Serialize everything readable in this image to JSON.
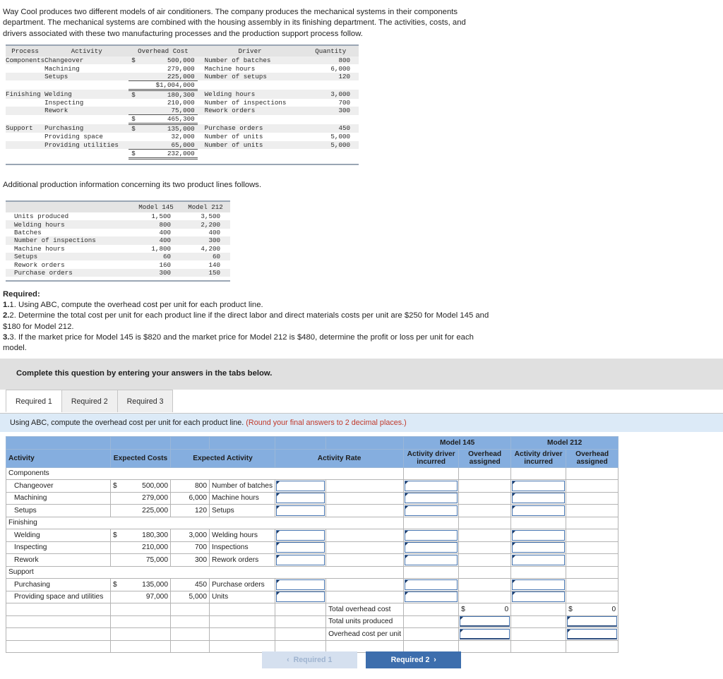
{
  "intro": "Way Cool produces two different models of air conditioners. The company produces the mechanical systems in their components department. The mechanical systems are combined with the housing assembly in its finishing department. The activities, costs, and drivers associated with these two manufacturing processes and the production support process follow.",
  "process_table": {
    "headers": [
      "Process",
      "Activity",
      "Overhead Cost",
      "Driver",
      "Quantity"
    ],
    "rows": [
      {
        "process": "Components",
        "activity": "Changeover",
        "dollar": "$",
        "cost": "500,000",
        "driver": "Number of batches",
        "qty": "800"
      },
      {
        "process": "",
        "activity": "Machining",
        "dollar": "",
        "cost": "279,000",
        "driver": "Machine hours",
        "qty": "6,000"
      },
      {
        "process": "",
        "activity": "Setups",
        "dollar": "",
        "cost": "225,000",
        "driver": "Number of setups",
        "qty": "120"
      },
      {
        "process": "",
        "activity": "",
        "dollar": "",
        "cost": "$1,004,000",
        "driver": "",
        "qty": ""
      },
      {
        "process": "Finishing",
        "activity": "Welding",
        "dollar": "$",
        "cost": "180,300",
        "driver": "Welding hours",
        "qty": "3,000"
      },
      {
        "process": "",
        "activity": "Inspecting",
        "dollar": "",
        "cost": "210,000",
        "driver": "Number of inspections",
        "qty": "700"
      },
      {
        "process": "",
        "activity": "Rework",
        "dollar": "",
        "cost": "75,000",
        "driver": "Rework orders",
        "qty": "300"
      },
      {
        "process": "",
        "activity": "",
        "dollar": "$",
        "cost": "465,300",
        "driver": "",
        "qty": ""
      },
      {
        "process": "Support",
        "activity": "Purchasing",
        "dollar": "$",
        "cost": "135,000",
        "driver": "Purchase orders",
        "qty": "450"
      },
      {
        "process": "",
        "activity": "Providing space",
        "dollar": "",
        "cost": "32,000",
        "driver": "Number of units",
        "qty": "5,000"
      },
      {
        "process": "",
        "activity": "Providing utilities",
        "dollar": "",
        "cost": "65,000",
        "driver": "Number of units",
        "qty": "5,000"
      },
      {
        "process": "",
        "activity": "",
        "dollar": "$",
        "cost": "232,000",
        "driver": "",
        "qty": ""
      }
    ]
  },
  "additional_note": "Additional production information concerning its two product lines follows.",
  "models_table": {
    "headers": [
      "",
      "Model 145",
      "Model 212"
    ],
    "rows": [
      {
        "label": "Units produced",
        "m145": "1,500",
        "m212": "3,500"
      },
      {
        "label": "Welding hours",
        "m145": "800",
        "m212": "2,200"
      },
      {
        "label": "Batches",
        "m145": "400",
        "m212": "400"
      },
      {
        "label": "Number of inspections",
        "m145": "400",
        "m212": "300"
      },
      {
        "label": "Machine hours",
        "m145": "1,800",
        "m212": "4,200"
      },
      {
        "label": "Setups",
        "m145": "60",
        "m212": "60"
      },
      {
        "label": "Rework orders",
        "m145": "160",
        "m212": "140"
      },
      {
        "label": "Purchase orders",
        "m145": "300",
        "m212": "150"
      }
    ]
  },
  "required": {
    "heading": "Required:",
    "item1": "1. Using ABC, compute the overhead cost per unit for each product line.",
    "item2": "2. Determine the total cost per unit for each product line if the direct labor and direct materials costs per unit are $250 for Model 145 and $180 for Model 212.",
    "item3": "3. If the market price for Model 145 is $820 and the market price for Model 212 is $480, determine the profit or loss per unit for each model."
  },
  "instruction_banner": "Complete this question by entering your answers in the tabs below.",
  "tabs": [
    {
      "label": "Required 1",
      "active": true
    },
    {
      "label": "Required 2",
      "active": false
    },
    {
      "label": "Required 3",
      "active": false
    }
  ],
  "question_banner": {
    "text": "Using ABC, compute the overhead cost per unit for each product line.",
    "note": "(Round your final answers to 2 decimal places.)",
    "note_color": "#c0392b"
  },
  "answer_grid": {
    "group_headers": [
      {
        "label": "Model 145",
        "span": 2
      },
      {
        "label": "Model 212",
        "span": 2
      }
    ],
    "column_headers": [
      "Activity",
      "Expected Costs",
      "Expected Activity",
      "Activity Rate",
      "Activity driver incurred",
      "Overhead assigned",
      "Activity driver incurred",
      "Overhead assigned"
    ],
    "sections": [
      {
        "name": "Components",
        "rows": [
          {
            "activity": "Changeover",
            "dollar": "$",
            "cost": "500,000",
            "qty": "800",
            "driver": "Number of batches"
          },
          {
            "activity": "Machining",
            "dollar": "",
            "cost": "279,000",
            "qty": "6,000",
            "driver": "Machine hours"
          },
          {
            "activity": "Setups",
            "dollar": "",
            "cost": "225,000",
            "qty": "120",
            "driver": "Setups"
          }
        ]
      },
      {
        "name": "Finishing",
        "rows": [
          {
            "activity": "Welding",
            "dollar": "$",
            "cost": "180,300",
            "qty": "3,000",
            "driver": "Welding hours"
          },
          {
            "activity": "Inspecting",
            "dollar": "",
            "cost": "210,000",
            "qty": "700",
            "driver": "Inspections"
          },
          {
            "activity": "Rework",
            "dollar": "",
            "cost": "75,000",
            "qty": "300",
            "driver": "Rework orders"
          }
        ]
      },
      {
        "name": "Support",
        "rows": [
          {
            "activity": "Purchasing",
            "dollar": "$",
            "cost": "135,000",
            "qty": "450",
            "driver": "Purchase orders"
          },
          {
            "activity": "Providing space and utilities",
            "dollar": "",
            "cost": "97,000",
            "qty": "5,000",
            "driver": "Units"
          }
        ]
      }
    ],
    "summary_rows": [
      {
        "label": "Total overhead cost",
        "m145_dollar": "$",
        "m145_value": "0",
        "m212_dollar": "$",
        "m212_value": "0",
        "input": false
      },
      {
        "label": "Total units produced",
        "m145_dollar": "",
        "m145_value": "",
        "m212_dollar": "",
        "m212_value": "",
        "input": true
      },
      {
        "label": "Overhead cost per unit",
        "m145_dollar": "",
        "m145_value": "",
        "m212_dollar": "",
        "m212_value": "",
        "input": true
      }
    ]
  },
  "nav": {
    "prev_label": "Required 1",
    "prev_chevron": "‹",
    "next_label": "Required 2",
    "next_chevron": "›",
    "prev_color": "#d5e0ef",
    "next_color": "#3d6ead"
  }
}
